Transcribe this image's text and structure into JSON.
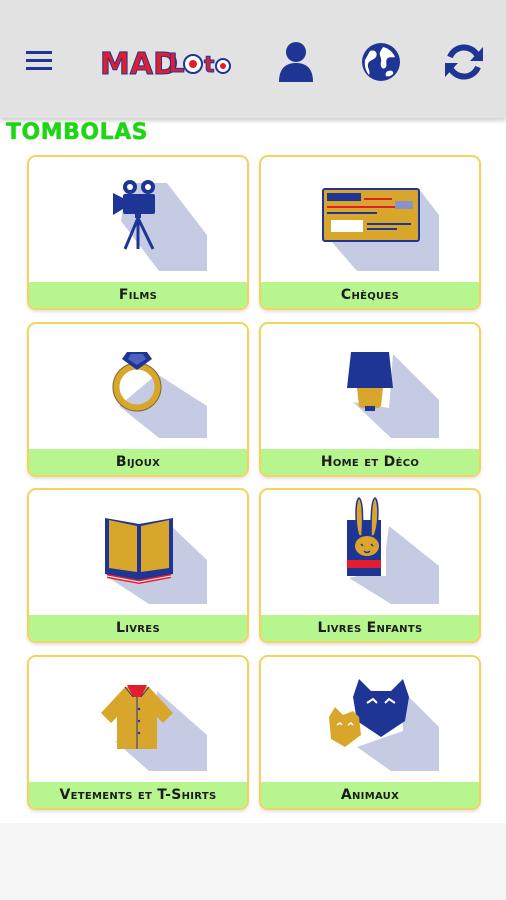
{
  "appbar": {
    "logo_text": "MADLOTO",
    "menu_icon": "hamburger-menu-icon",
    "user_icon": "user-icon",
    "globe_icon": "globe-icon",
    "refresh_icon": "refresh-icon"
  },
  "section": {
    "title": "TOMBOLAS"
  },
  "categories": [
    {
      "label": "Films",
      "icon": "movie-camera-icon"
    },
    {
      "label": "Chèques",
      "icon": "cheque-icon"
    },
    {
      "label": "Bijoux",
      "icon": "ring-icon"
    },
    {
      "label": "Home et Déco",
      "icon": "lamp-icon"
    },
    {
      "label": "Livres",
      "icon": "book-icon"
    },
    {
      "label": "Livres Enfants",
      "icon": "children-book-icon"
    },
    {
      "label": "Vetements et T-Shirts",
      "icon": "shirt-icon"
    },
    {
      "label": "Animaux",
      "icon": "animals-icon"
    }
  ],
  "colors": {
    "title_green": "#1ad90f",
    "card_border": "#f4d35e",
    "label_bg": "#b7f58f",
    "icon_blue": "#1f3596",
    "appbar_bg": "#e2e2e2"
  }
}
